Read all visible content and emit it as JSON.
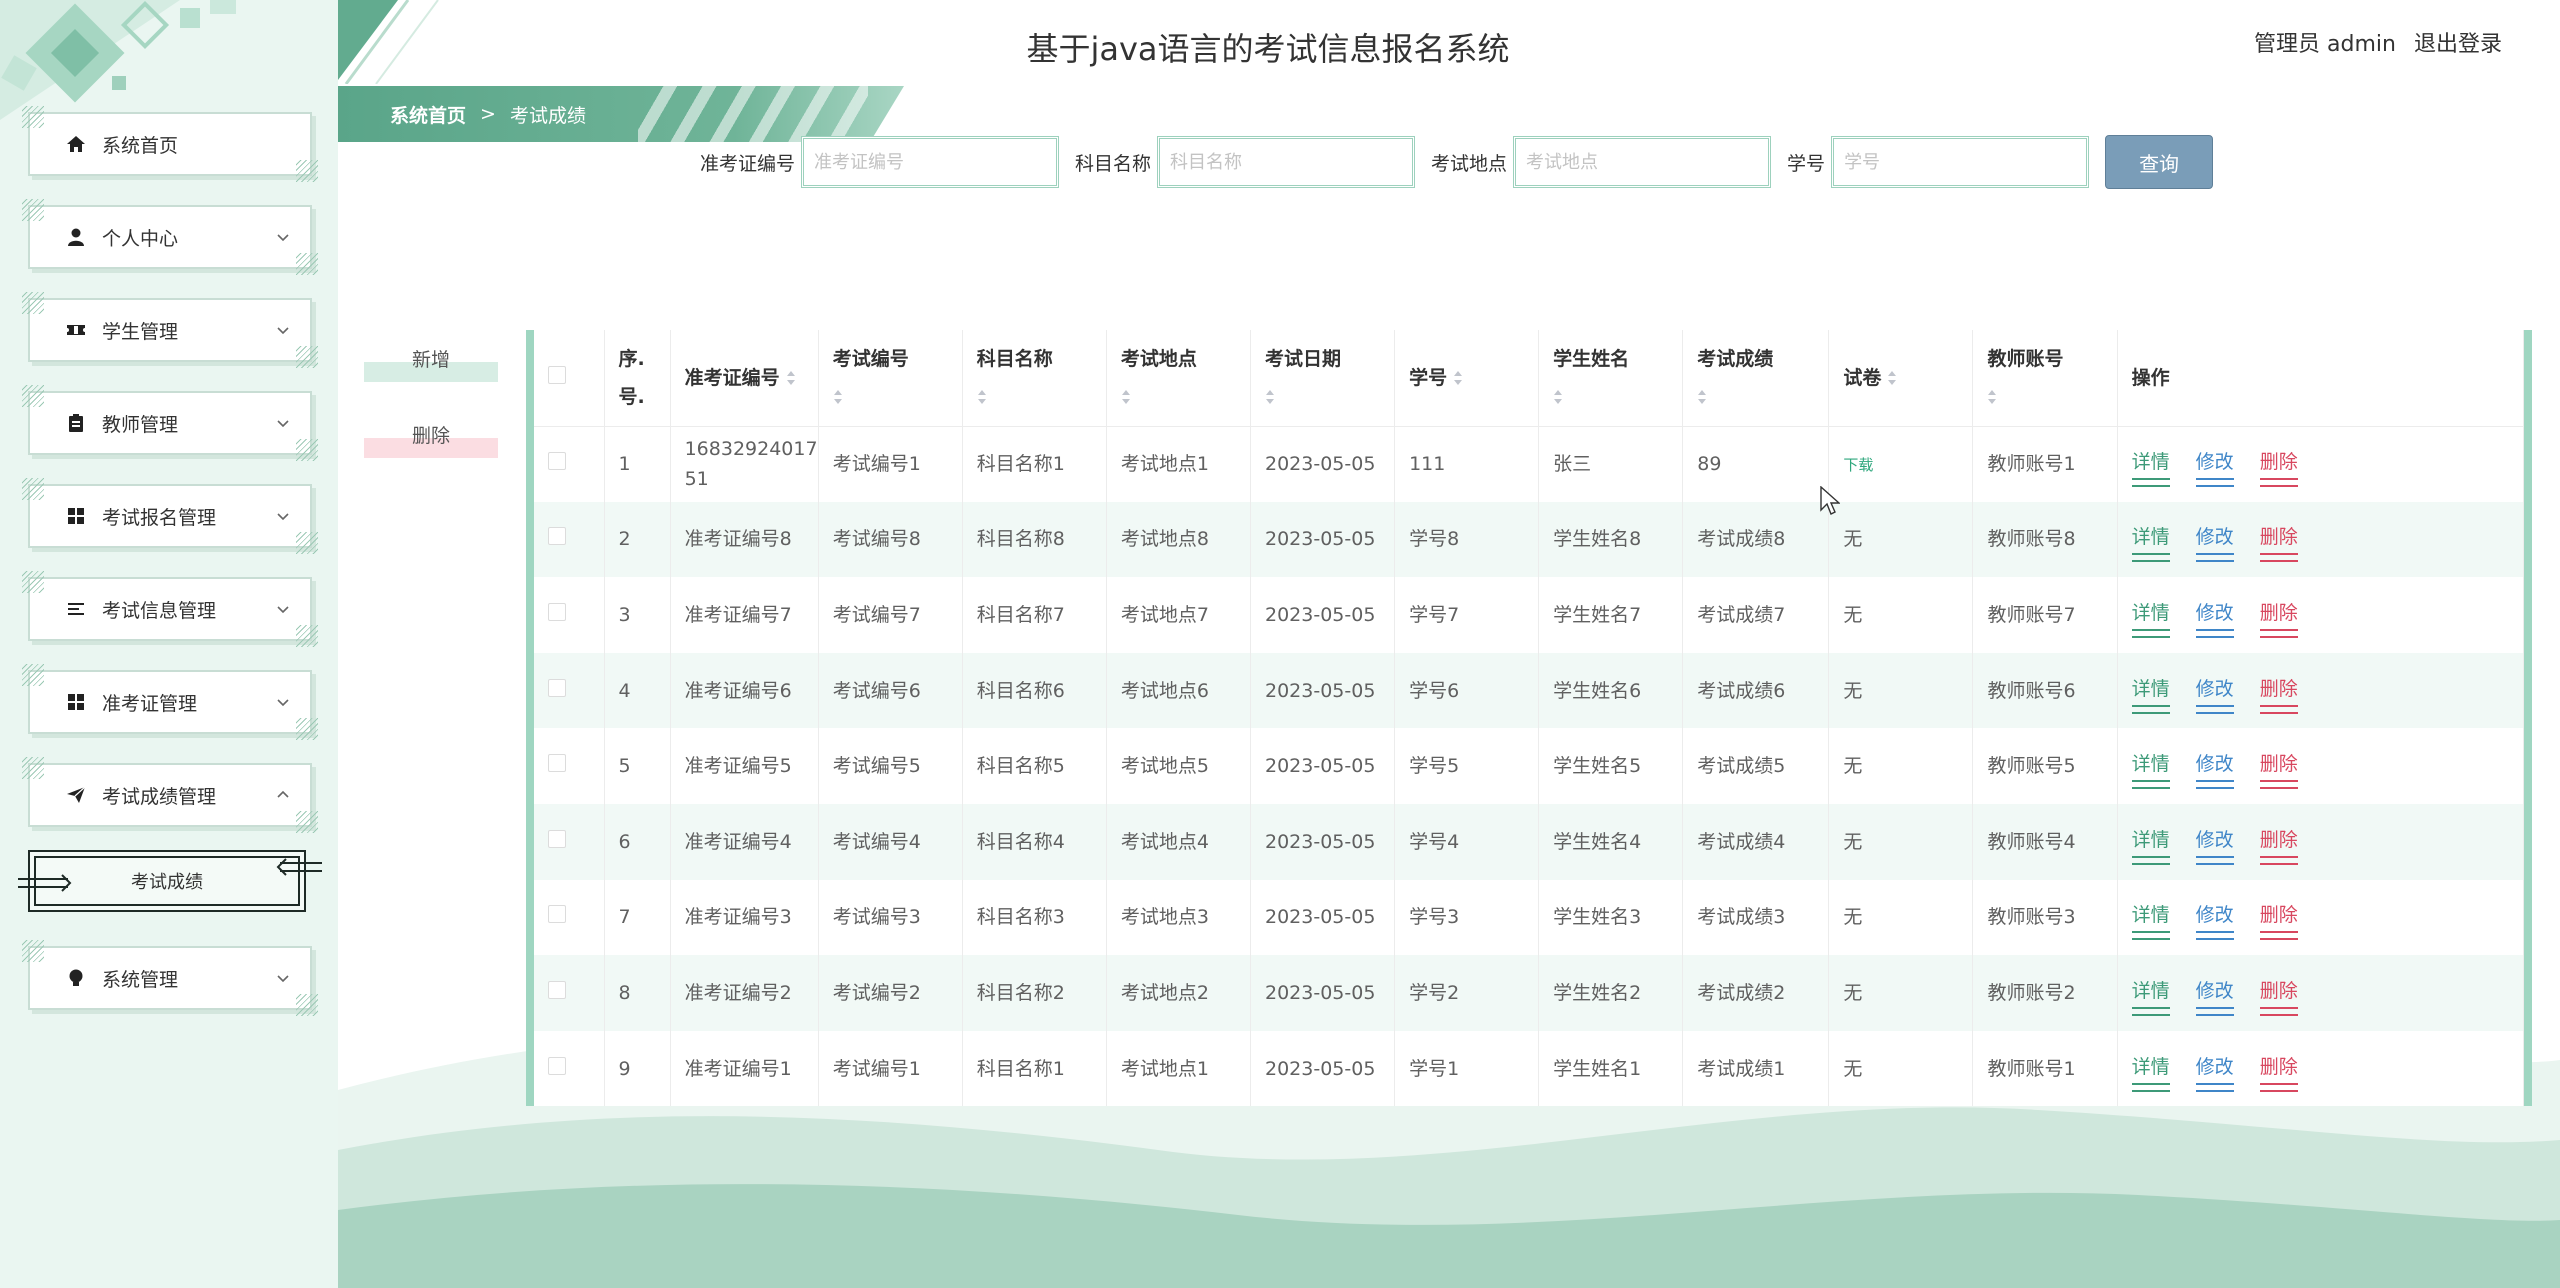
{
  "header": {
    "title": "基于java语言的考试信息报名系统",
    "user_label": "管理员 admin",
    "logout_label": "退出登录"
  },
  "breadcrumb": {
    "home": "系统首页",
    "separator": ">",
    "current": "考试成绩"
  },
  "sidebar": {
    "items": [
      {
        "label": "系统首页",
        "icon": "home-icon"
      },
      {
        "label": "个人中心",
        "icon": "user-icon"
      },
      {
        "label": "学生管理",
        "icon": "ticket-icon"
      },
      {
        "label": "教师管理",
        "icon": "clipboard-icon"
      },
      {
        "label": "考试报名管理",
        "icon": "grid-icon"
      },
      {
        "label": "考试信息管理",
        "icon": "list-icon"
      },
      {
        "label": "准考证管理",
        "icon": "grid-icon"
      },
      {
        "label": "考试成绩管理",
        "icon": "send-icon"
      },
      {
        "label": "系统管理",
        "icon": "bulb-icon"
      }
    ],
    "active_submenu": "考试成绩"
  },
  "search": {
    "fields": [
      {
        "label": "准考证编号",
        "placeholder": "准考证编号"
      },
      {
        "label": "科目名称",
        "placeholder": "科目名称"
      },
      {
        "label": "考试地点",
        "placeholder": "考试地点"
      },
      {
        "label": "学号",
        "placeholder": "学号"
      }
    ],
    "query_label": "查询"
  },
  "actions": {
    "add_label": "新增",
    "delete_label": "删除"
  },
  "table": {
    "headers": {
      "index": "序.号.",
      "ticket_no": "准考证编号",
      "exam_no": "考试编号",
      "subject": "科目名称",
      "location": "考试地点",
      "date": "考试日期",
      "student_no": "学号",
      "student_name": "学生姓名",
      "score": "考试成绩",
      "paper": "试卷",
      "teacher": "教师账号",
      "ops": "操作"
    },
    "ops": {
      "detail": "详情",
      "edit": "修改",
      "delete": "删除"
    },
    "rows": [
      {
        "index": "1",
        "ticket_no": "1683292401751",
        "exam_no": "考试编号1",
        "subject": "科目名称1",
        "location": "考试地点1",
        "date": "2023-05-05",
        "student_no": "111",
        "student_name": "张三",
        "score": "89",
        "paper": "下载",
        "teacher": "教师账号1"
      },
      {
        "index": "2",
        "ticket_no": "准考证编号8",
        "exam_no": "考试编号8",
        "subject": "科目名称8",
        "location": "考试地点8",
        "date": "2023-05-05",
        "student_no": "学号8",
        "student_name": "学生姓名8",
        "score": "考试成绩8",
        "paper": "无",
        "teacher": "教师账号8"
      },
      {
        "index": "3",
        "ticket_no": "准考证编号7",
        "exam_no": "考试编号7",
        "subject": "科目名称7",
        "location": "考试地点7",
        "date": "2023-05-05",
        "student_no": "学号7",
        "student_name": "学生姓名7",
        "score": "考试成绩7",
        "paper": "无",
        "teacher": "教师账号7"
      },
      {
        "index": "4",
        "ticket_no": "准考证编号6",
        "exam_no": "考试编号6",
        "subject": "科目名称6",
        "location": "考试地点6",
        "date": "2023-05-05",
        "student_no": "学号6",
        "student_name": "学生姓名6",
        "score": "考试成绩6",
        "paper": "无",
        "teacher": "教师账号6"
      },
      {
        "index": "5",
        "ticket_no": "准考证编号5",
        "exam_no": "考试编号5",
        "subject": "科目名称5",
        "location": "考试地点5",
        "date": "2023-05-05",
        "student_no": "学号5",
        "student_name": "学生姓名5",
        "score": "考试成绩5",
        "paper": "无",
        "teacher": "教师账号5"
      },
      {
        "index": "6",
        "ticket_no": "准考证编号4",
        "exam_no": "考试编号4",
        "subject": "科目名称4",
        "location": "考试地点4",
        "date": "2023-05-05",
        "student_no": "学号4",
        "student_name": "学生姓名4",
        "score": "考试成绩4",
        "paper": "无",
        "teacher": "教师账号4"
      },
      {
        "index": "7",
        "ticket_no": "准考证编号3",
        "exam_no": "考试编号3",
        "subject": "科目名称3",
        "location": "考试地点3",
        "date": "2023-05-05",
        "student_no": "学号3",
        "student_name": "学生姓名3",
        "score": "考试成绩3",
        "paper": "无",
        "teacher": "教师账号3"
      },
      {
        "index": "8",
        "ticket_no": "准考证编号2",
        "exam_no": "考试编号2",
        "subject": "科目名称2",
        "location": "考试地点2",
        "date": "2023-05-05",
        "student_no": "学号2",
        "student_name": "学生姓名2",
        "score": "考试成绩2",
        "paper": "无",
        "teacher": "教师账号2"
      },
      {
        "index": "9",
        "ticket_no": "准考证编号1",
        "exam_no": "考试编号1",
        "subject": "科目名称1",
        "location": "考试地点1",
        "date": "2023-05-05",
        "student_no": "学号1",
        "student_name": "学生姓名1",
        "score": "考试成绩1",
        "paper": "无",
        "teacher": "教师账号1"
      }
    ]
  },
  "colors": {
    "accent_green": "#5aa589",
    "query_button": "#7a9db8",
    "detail": "#3d9a78",
    "edit": "#3f86c8",
    "delete": "#d8475f"
  }
}
